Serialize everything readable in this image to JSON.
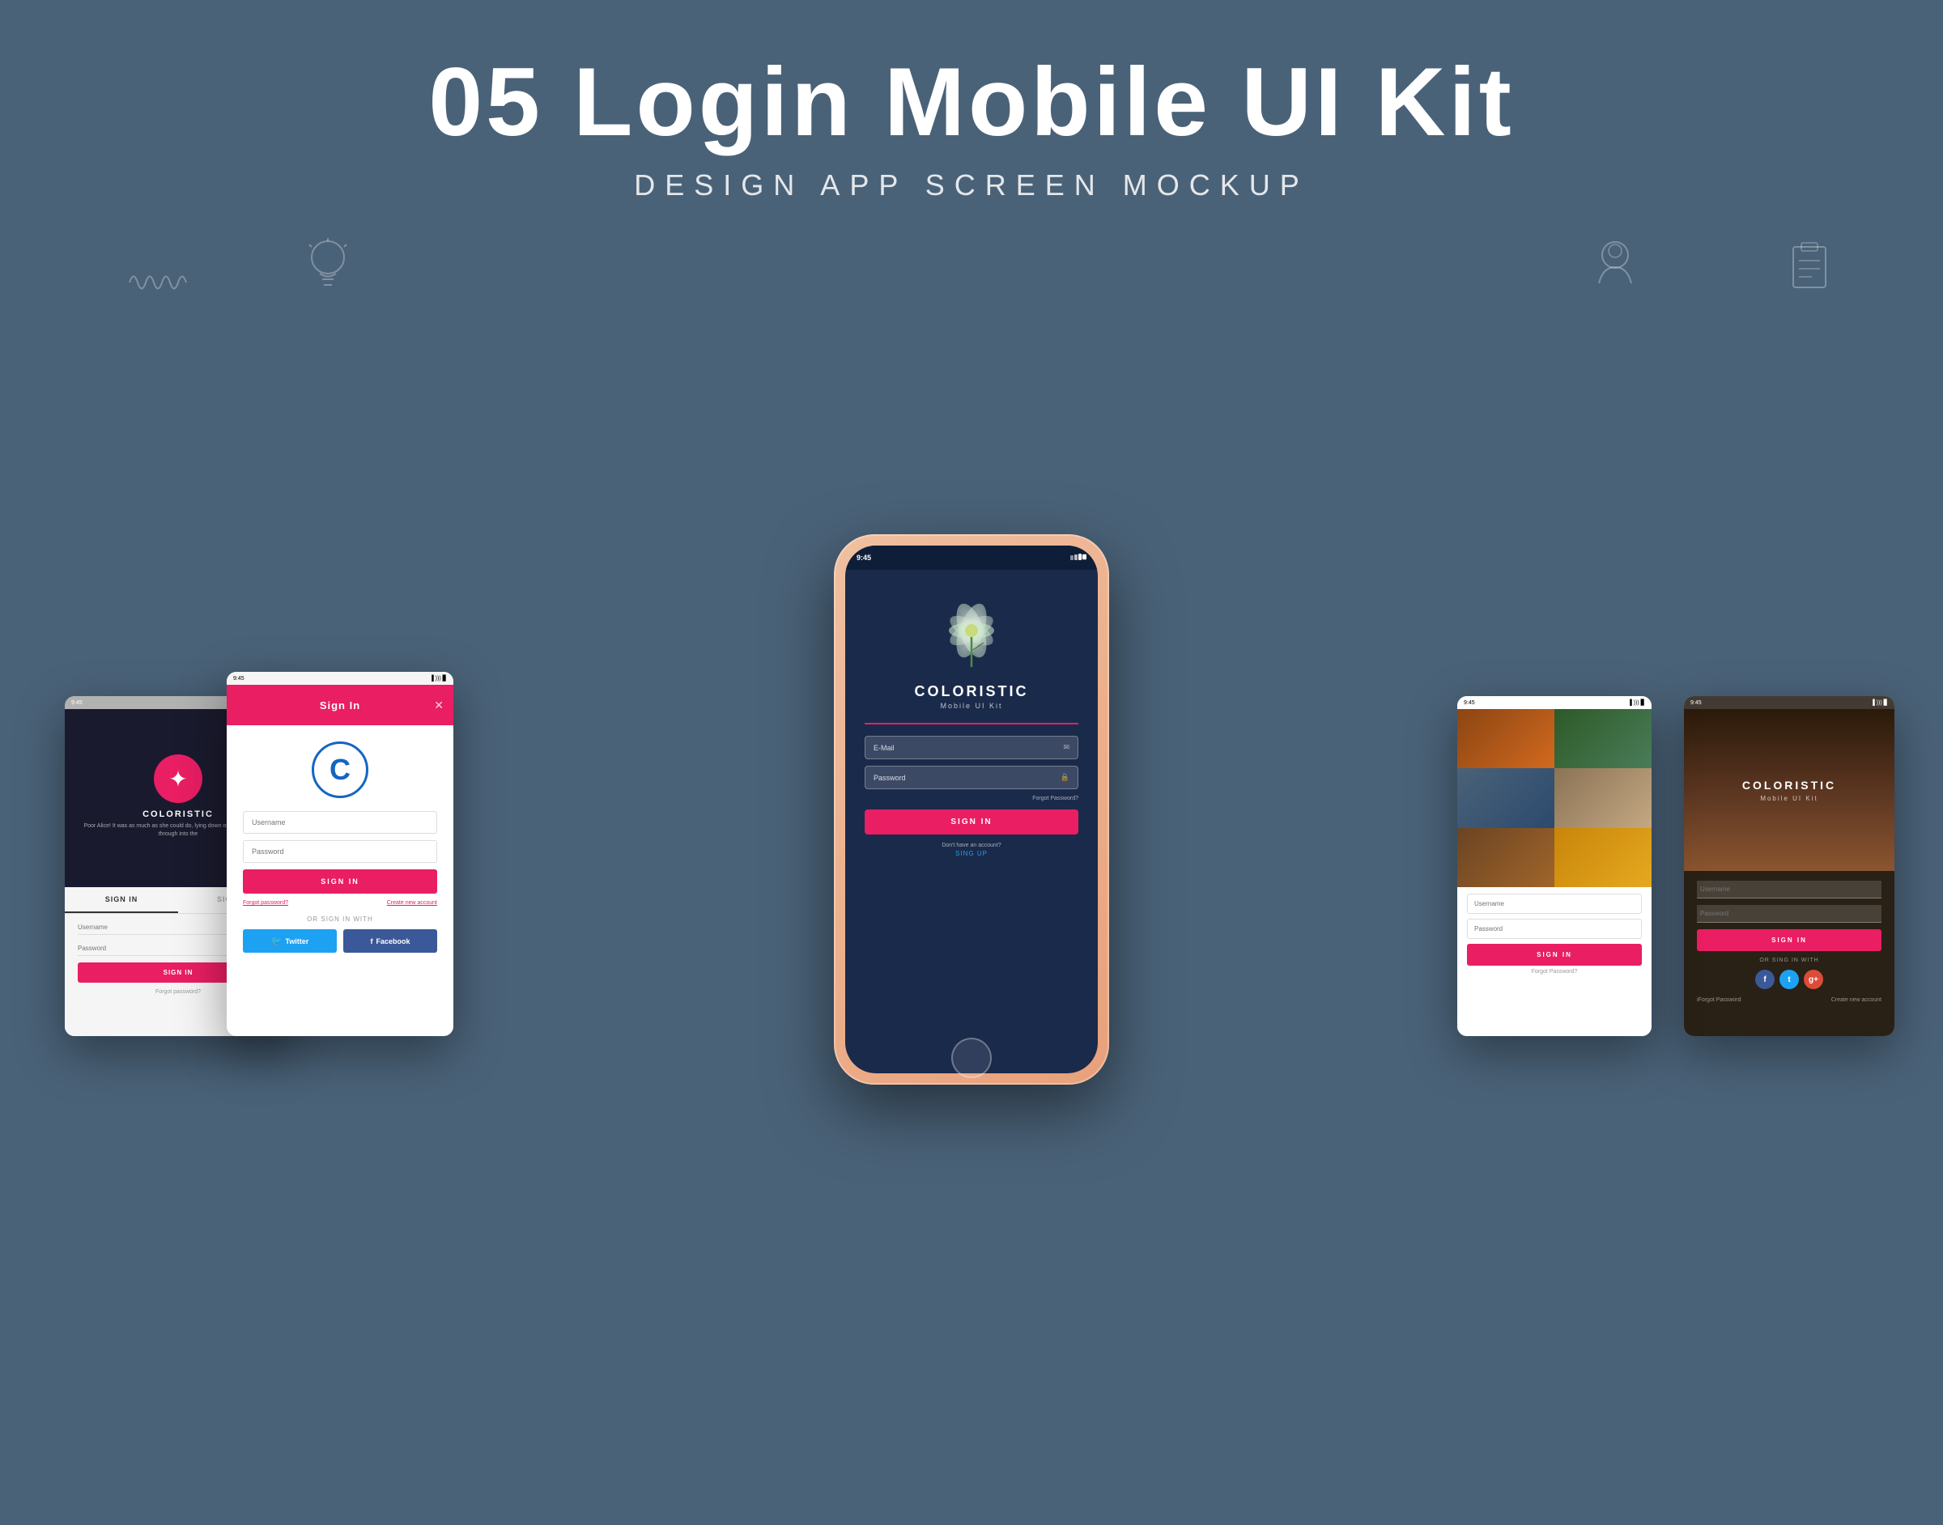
{
  "header": {
    "title": "05 Login Mobile UI Kit",
    "subtitle": "DESIGN APP SCREEN MOCKUP"
  },
  "screen1": {
    "status_time": "9:45",
    "brand": "COLORISTIC",
    "tagline": "Poor Alice! It was as much as she could do, lying down on one aide, to look through into the",
    "tab_signin": "SIGN IN",
    "tab_signup": "SIGN UP",
    "input_username": "Username",
    "input_password": "Password",
    "btn_signin": "SIGN IN",
    "forgot_password": "Forgot password?"
  },
  "screen2": {
    "status_time": "9:45",
    "header_title": "Sign In",
    "logo_letter": "C",
    "input_username": "Username",
    "input_password": "Password",
    "btn_signin": "SIGN IN",
    "forgot_password": "Forgot password?",
    "create_account": "Create new account",
    "or_sign_in_with": "OR SIGN IN WITH",
    "btn_twitter": "Twitter",
    "btn_facebook": "Facebook"
  },
  "screen3_center": {
    "status_time": "9:45",
    "brand": "COLORISTIC",
    "kit": "Mobile UI Kit",
    "input_email": "E-Mail",
    "input_password": "Password",
    "forgot_password": "Forgot Password?",
    "btn_signin": "SIGN IN",
    "no_account": "Don't have an account?",
    "signup_link": "SING UP"
  },
  "screen4": {
    "status_time": "9:45",
    "input_username": "Username",
    "input_password": "Password",
    "btn_signin": "SIGN IN",
    "forgot_password": "Forgot Password?"
  },
  "screen5": {
    "status_time": "9:45",
    "brand": "COLORISTIC",
    "kit": "Mobile UI Kit",
    "input_username": "Username",
    "input_password": "Password",
    "btn_signin": "SIGN IN",
    "or_sign_in_with": "OR SING IN WITH",
    "btn_forgot": "iForgot Password",
    "btn_create": "Create new account"
  }
}
